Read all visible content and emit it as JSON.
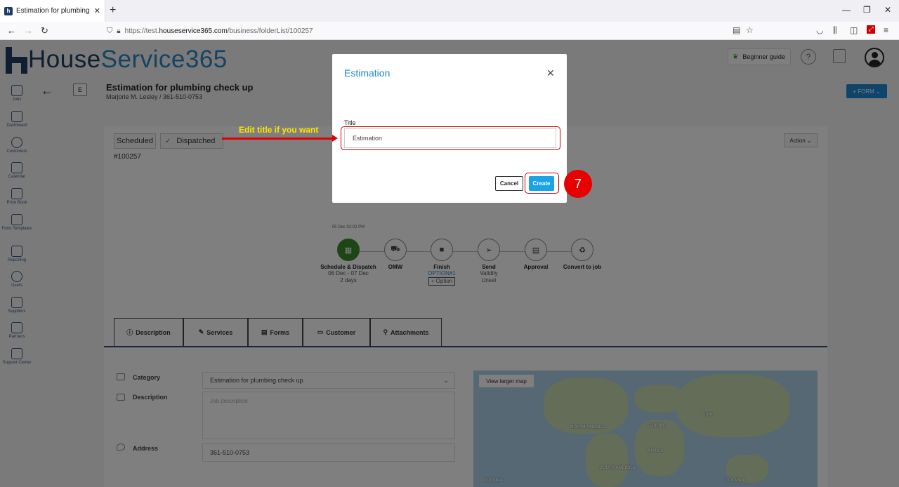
{
  "browser": {
    "tab_title": "Estimation for plumbing check",
    "tab_close": "✕",
    "new_tab": "+",
    "url_prefix": "https://test.",
    "url_domain": "houseservice365.com",
    "url_path": "/business/folderList/100257",
    "window_controls": [
      "—",
      "❐",
      "✕"
    ]
  },
  "app": {
    "logo_part1": "House",
    "logo_part2": "Service365",
    "beginner_guide": "Beginner guide",
    "help": "?",
    "sidebar": [
      {
        "label": "Jobs"
      },
      {
        "label": "Dashboard"
      },
      {
        "label": "Customers"
      },
      {
        "label": "Calendar"
      },
      {
        "label": "Price Book"
      },
      {
        "label": "Form Templates"
      },
      {
        "label": "Reporting"
      },
      {
        "label": "Users"
      },
      {
        "label": "Suppliers"
      },
      {
        "label": "Partners"
      },
      {
        "label": "Support Center"
      }
    ],
    "back": "←",
    "badge": "E",
    "job_title": "Estimation for plumbing check up",
    "job_subtitle": "Marjorie M. Lesley / 361-510-0753",
    "form_button": "+ FORM ⌄",
    "status_scheduled": "Scheduled",
    "status_dispatched": "Dispatched",
    "job_number": "#100257",
    "action": "Action ⌄",
    "steps": [
      {
        "date": "05 Dec 02:02 PM",
        "label": "Schedule & Dispatch",
        "sub": "06 Dec - 07 Dec",
        "sub2": "2 days",
        "icon": "calendar-icon",
        "done": true
      },
      {
        "date": "",
        "label": "OMW",
        "sub": "",
        "sub2": "",
        "icon": "truck-icon"
      },
      {
        "date": "",
        "label": "Finish",
        "sub": "OPTION#1",
        "sub2": "+ Option",
        "icon": "stop-icon"
      },
      {
        "date": "",
        "label": "Send",
        "sub": "Validity",
        "sub2": "Unset",
        "icon": "send-icon"
      },
      {
        "date": "",
        "label": "Approval",
        "sub": "",
        "sub2": "",
        "icon": "document-icon"
      },
      {
        "date": "",
        "label": "Convert to job",
        "sub": "",
        "sub2": "",
        "icon": "recycle-icon"
      }
    ],
    "tabs": [
      {
        "label": "Description",
        "icon": "info-icon"
      },
      {
        "label": "Services",
        "icon": "wrench-icon"
      },
      {
        "label": "Forms",
        "icon": "form-icon"
      },
      {
        "label": "Customer",
        "icon": "card-icon"
      },
      {
        "label": "Attachments",
        "icon": "paperclip-icon"
      }
    ],
    "fields": {
      "category_label": "Category",
      "category_value": "Estimation for plumbing check up",
      "description_label": "Description",
      "description_placeholder": "Job description",
      "address_label": "Address",
      "address_value": "361-510-0753"
    },
    "map": {
      "view_larger": "View larger map",
      "labels": [
        "NORTH AMERICA",
        "EUROPE",
        "ASIA",
        "AFRICA",
        "SOUTH AMERICA",
        "OCEANIA",
        "OCEANIA"
      ]
    }
  },
  "modal": {
    "title": "Estimation",
    "close": "✕",
    "field_label": "Title",
    "field_value": "Estimation",
    "cancel": "Cancel",
    "create": "Create"
  },
  "annotation": {
    "callout": "Edit title if you want",
    "step_number": "7",
    "colors": {
      "callout": "#ffe600",
      "highlight": "#cc0000",
      "badge": "#e60000"
    }
  }
}
